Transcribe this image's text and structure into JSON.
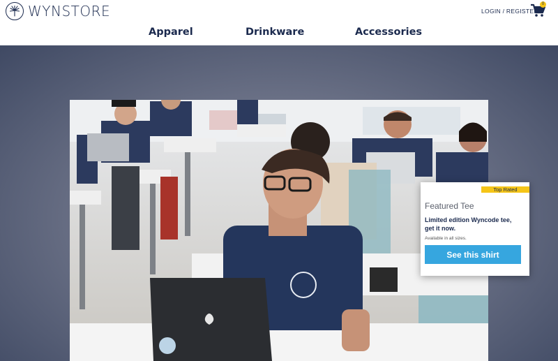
{
  "brand": {
    "name": "WYNSTORE",
    "logo_icon": "palm-tree-icon"
  },
  "header": {
    "auth_label": "LOGIN / REGISTER",
    "cart_icon": "cart-icon",
    "cart_count": "0"
  },
  "nav": {
    "items": [
      {
        "label": "Apparel"
      },
      {
        "label": "Drinkware"
      },
      {
        "label": "Accessories"
      }
    ]
  },
  "featured": {
    "badge": "Top Rated",
    "title": "Featured Tee",
    "description": "Limited edition Wyncode tee, get it now.",
    "subtext": "Available in all sizes.",
    "button_label": "See this shirt"
  },
  "colors": {
    "brand_navy": "#1b2a4e",
    "accent_blue": "#36a6df",
    "badge_yellow": "#f5c518"
  }
}
